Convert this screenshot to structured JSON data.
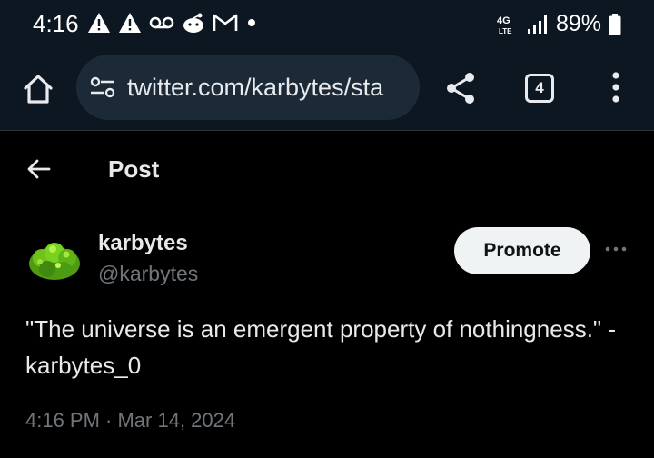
{
  "status_bar": {
    "time": "4:16",
    "network_label": "4G LTE",
    "battery": "89%",
    "icons": [
      "warning-icon",
      "warning-icon",
      "voicemail-icon",
      "reddit-icon",
      "gmail-icon",
      "dot-icon",
      "network-icon",
      "signal-icon",
      "battery-icon"
    ]
  },
  "browser": {
    "url": "twitter.com/karbytes/sta",
    "tab_count": "4",
    "icons": [
      "home-icon",
      "site-settings-icon",
      "share-icon",
      "tabs-icon",
      "more-vert-icon"
    ]
  },
  "post_header": {
    "title": "Post"
  },
  "tweet": {
    "display_name": "karbytes",
    "handle": "@karbytes",
    "promote_label": "Promote",
    "text": "\"The universe is an emergent property of nothingness.\" - karbytes_0",
    "timestamp": "4:16 PM · Mar 14, 2024"
  },
  "colors": {
    "chrome_bg": "#0d1722",
    "url_bar_bg": "#1c2a38",
    "page_bg": "#000000",
    "muted_text": "#71767b",
    "promote_bg": "#eff3f4"
  }
}
